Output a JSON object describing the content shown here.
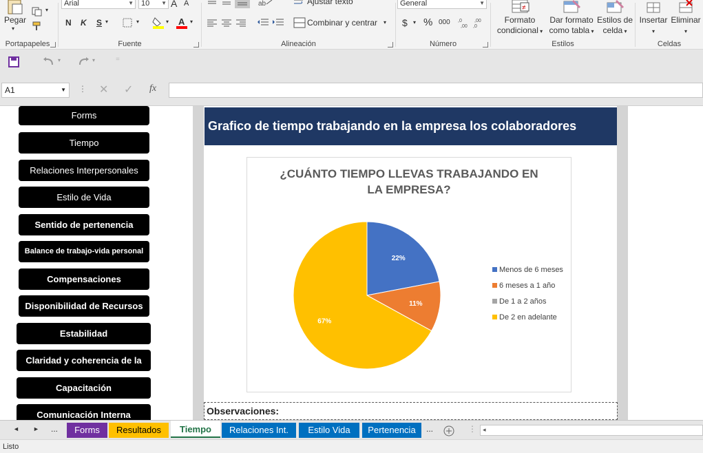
{
  "ribbon": {
    "clipboard": {
      "paste_label": "Pegar",
      "group_label": "Portapapeles"
    },
    "font": {
      "name": "Arial",
      "size": "10",
      "bold": "N",
      "italic": "K",
      "underline": "S",
      "increase": "A",
      "decrease": "A",
      "group_label": "Fuente"
    },
    "alignment": {
      "wrap_label": "Ajustar texto",
      "merge_label": "Combinar y centrar",
      "group_label": "Alineación"
    },
    "number": {
      "format_value": "General",
      "currency": "$",
      "percent": "%",
      "thousands": "000",
      "group_label": "Número"
    },
    "styles": {
      "conditional_line1": "Formato",
      "conditional_line2": "condicional",
      "table_line1": "Dar formato",
      "table_line2": "como tabla",
      "cell_line1": "Estilos de",
      "cell_line2": "celda",
      "group_label": "Estilos"
    },
    "cells": {
      "insert_label": "Insertar",
      "delete_label": "Eliminar",
      "group_label": "Celdas"
    }
  },
  "formula_bar": {
    "name_box": "A1",
    "fx": "fx",
    "value": ""
  },
  "sheet": {
    "nav_buttons": [
      "Forms",
      "Tiempo",
      "Relaciones Interpersonales",
      "Estilo de Vida",
      "Sentido de pertenencia",
      "Balance de trabajo-vida personal",
      "Compensaciones",
      "Disponibilidad de Recursos",
      "Estabilidad",
      "Claridad y coherencia de la",
      "Capacitación",
      "Comunicación Interna"
    ],
    "banner_title": "Grafico de tiempo trabajando en la empresa los colaboradores",
    "observations_label": "Observaciones:"
  },
  "chart_data": {
    "type": "pie",
    "title_line1": "¿CUÁNTO TIEMPO LLEVAS TRABAJANDO EN",
    "title_line2": "LA EMPRESA?",
    "categories": [
      "Menos de 6 meses",
      "6 meses a 1 año",
      "De 1 a 2 años",
      "De 2 en adelante"
    ],
    "values": [
      22,
      11,
      0,
      67
    ],
    "data_labels": [
      "22%",
      "11%",
      "",
      "67%"
    ],
    "colors": [
      "#4472c4",
      "#ed7d31",
      "#a5a5a5",
      "#ffc000"
    ],
    "legend_position": "right"
  },
  "tabs": {
    "items": [
      {
        "label": "Forms",
        "bg": "#7030a0",
        "fg": "#ffffff"
      },
      {
        "label": "Resultados",
        "bg": "#ffc000",
        "fg": "#000000"
      },
      {
        "label": "Tiempo",
        "bg": "#ffffff",
        "fg": "#217346"
      },
      {
        "label": "Relaciones Int.",
        "bg": "#0070c0",
        "fg": "#ffffff"
      },
      {
        "label": "Estilo Vida",
        "bg": "#0070c0",
        "fg": "#ffffff"
      },
      {
        "label": "Pertenencia",
        "bg": "#0070c0",
        "fg": "#ffffff"
      }
    ],
    "ellipsis": "..."
  },
  "status": {
    "text": "Listo"
  }
}
